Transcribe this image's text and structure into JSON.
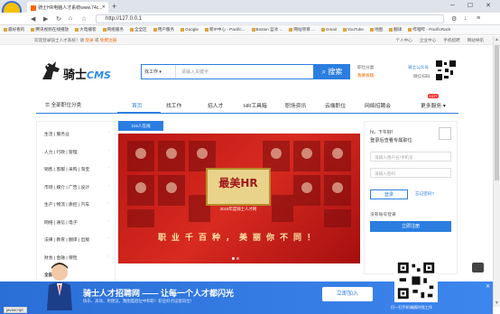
{
  "browser": {
    "tab_title": "骑士HR电脑人才系统www.74c...",
    "url": "http://127.0.0.1",
    "bookmarks": [
      "最好看的",
      "腾讯视频在线播放",
      "大电播客",
      "网络服务",
      "全全区",
      "用户服务",
      "Google",
      "新IP中心 - Pacific...",
      "Boston 蓝冰 ...",
      "网站项目 ...",
      "Gmail",
      "YouTube",
      "地图",
      "翻译",
      "哔哩哔 - PacificRack"
    ]
  },
  "topstrip": {
    "welcome": "欢迎登录骑士人才系统！请",
    "login": "登录",
    "or": "或",
    "register": "免费注册",
    "links": [
      "个人中心",
      "企业中心",
      "手机招聘",
      "网站导航"
    ]
  },
  "header": {
    "brand_cn": "骑士",
    "brand_en": "CMS",
    "search_select": "找工作 ▾",
    "search_placeholder": "请输入关键字",
    "search_button": "搜索",
    "service_label": "职位分类",
    "service_link": "我要投稿",
    "wechat_label": "骑士公众号",
    "wechat_sub": "微信扫码"
  },
  "nav": {
    "category": "全部职位分类",
    "items": [
      "首页",
      "找工作",
      "招人才",
      "HR工具箱",
      "职场资讯",
      "云端职位",
      "网络招聘会",
      "更多服务"
    ],
    "hot_badge": "HOT"
  },
  "left_categories": [
    "生活 | 服务业",
    "人力 | 行政 | 管理",
    "销售 | 客服 | 采购 | 淘宝",
    "市场 | 媒介 | 广告 | 设计",
    "生产 | 物流 | 质控 | 汽车",
    "网络 | 通信 | 电子",
    "法律 | 教育 | 翻译 | 出版",
    "财会 | 金融 | 保险",
    "全部职位"
  ],
  "banner": {
    "badge": "119人在线",
    "hr_title": "最美HR",
    "hr_subtitle": "2019年度骑士人才网",
    "slogan": "职业千百种，美丽你不同！"
  },
  "login": {
    "greeting": "hi，下午好!",
    "subtitle": "登录后查看专属职位",
    "user_placeholder": "请输入用户名/手机号",
    "pass_placeholder": "请输入密码",
    "login_button": "登录",
    "forgot": "忘记密码?",
    "no_account": "没有账号登录",
    "register_button": "立即注册"
  },
  "footer": {
    "title": "骑士人才招聘网 —— 让每一个人才都闪光",
    "subtitle": "快乐、高效、用建议，我图度趋位中和职！职业好点设意岗位！",
    "join_button": "立即加入",
    "qr_text": "扫一扫手机端随时找工作"
  },
  "status": {
    "js": "javascript:"
  }
}
